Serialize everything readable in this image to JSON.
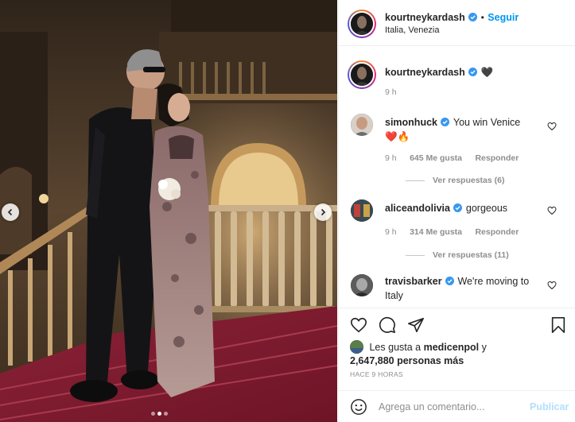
{
  "post": {
    "author": "kourtneykardash",
    "follow_label": "Seguir",
    "location": "Italia, Venezia"
  },
  "caption": {
    "author": "kourtneykardash",
    "emoji": "🖤",
    "age": "9 h"
  },
  "comments": [
    {
      "user": "simonhuck",
      "text": "You win Venice",
      "text2": "❤️🔥",
      "age": "9 h",
      "likes": "645 Me gusta",
      "reply_label": "Responder",
      "view_replies": "Ver respuestas (6)"
    },
    {
      "user": "aliceandolivia",
      "text": "gorgeous",
      "age": "9 h",
      "likes": "314 Me gusta",
      "reply_label": "Responder",
      "view_replies": "Ver respuestas (11)"
    },
    {
      "user": "travisbarker",
      "text": "We're moving to",
      "text2": "Italy"
    }
  ],
  "likes": {
    "prefix": "Les gusta a",
    "user": "medicenpol",
    "conj": "y",
    "count": "2,647,880 personas más"
  },
  "timestamp": "HACE 9 HORAS",
  "add_comment": {
    "placeholder": "Agrega un comentario...",
    "publish": "Publicar"
  },
  "icons": {
    "like": "heart-icon",
    "comment": "comment-icon",
    "share": "share-icon",
    "save": "bookmark-icon",
    "emoji": "emoji-icon",
    "verified": "verified-badge-icon"
  },
  "colors": {
    "link": "#0095f6",
    "verified": "#3897f0",
    "publish_disabled": "#b2dffc",
    "muted": "#8e8e8e"
  },
  "carousel": {
    "slides": 3,
    "active": 2
  }
}
